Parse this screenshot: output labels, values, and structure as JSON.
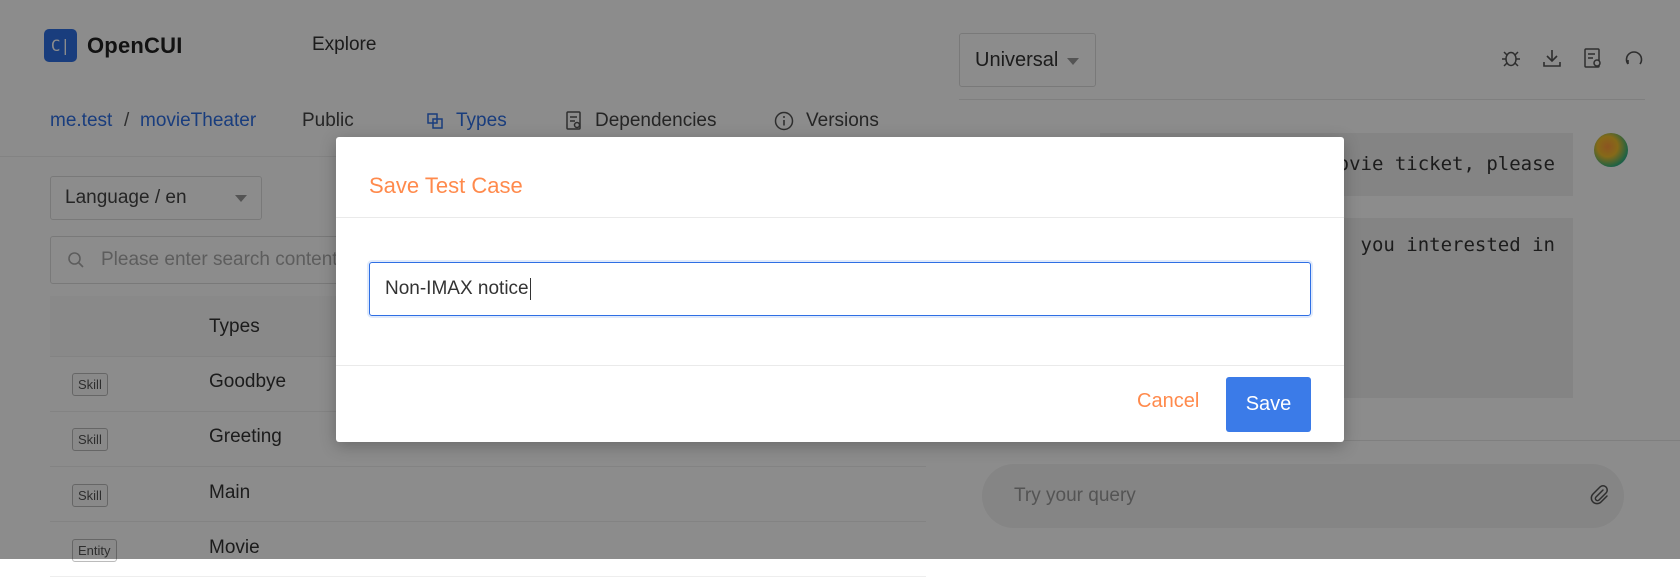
{
  "app": {
    "logo_mark": "C|",
    "name": "OpenCUI",
    "nav_explore": "Explore"
  },
  "breadcrumb": {
    "org": "me.test",
    "separator": "/",
    "project": "movieTheater",
    "visibility": "Public"
  },
  "tabs": [
    {
      "label": "Types",
      "icon": "types-icon"
    },
    {
      "label": "Dependencies",
      "icon": "dependencies-icon"
    },
    {
      "label": "Versions",
      "icon": "info-icon"
    }
  ],
  "language_select": {
    "value": "Language / en"
  },
  "search": {
    "placeholder": "Please enter search content"
  },
  "types_table": {
    "header": "Types",
    "rows": [
      {
        "tag": "Skill",
        "name": "Goodbye"
      },
      {
        "tag": "Skill",
        "name": "Greeting"
      },
      {
        "tag": "Skill",
        "name": "Main"
      },
      {
        "tag": "Entity",
        "name": "Movie"
      }
    ]
  },
  "right_panel": {
    "channel_select": "Universal",
    "toolbar_icons": [
      "bug-icon",
      "download-icon",
      "report-icon",
      "reset-icon"
    ],
    "messages": [
      {
        "text": "ovie ticket, please"
      },
      {
        "text": "you interested in"
      }
    ],
    "query_placeholder": "Try your query"
  },
  "modal": {
    "title": "Save Test Case",
    "input_value": "Non-IMAX notice",
    "cancel_label": "Cancel",
    "save_label": "Save"
  },
  "colors": {
    "accent": "#2f6fe4",
    "title_orange": "#ff8a4c",
    "save_button": "#3b7be8"
  }
}
